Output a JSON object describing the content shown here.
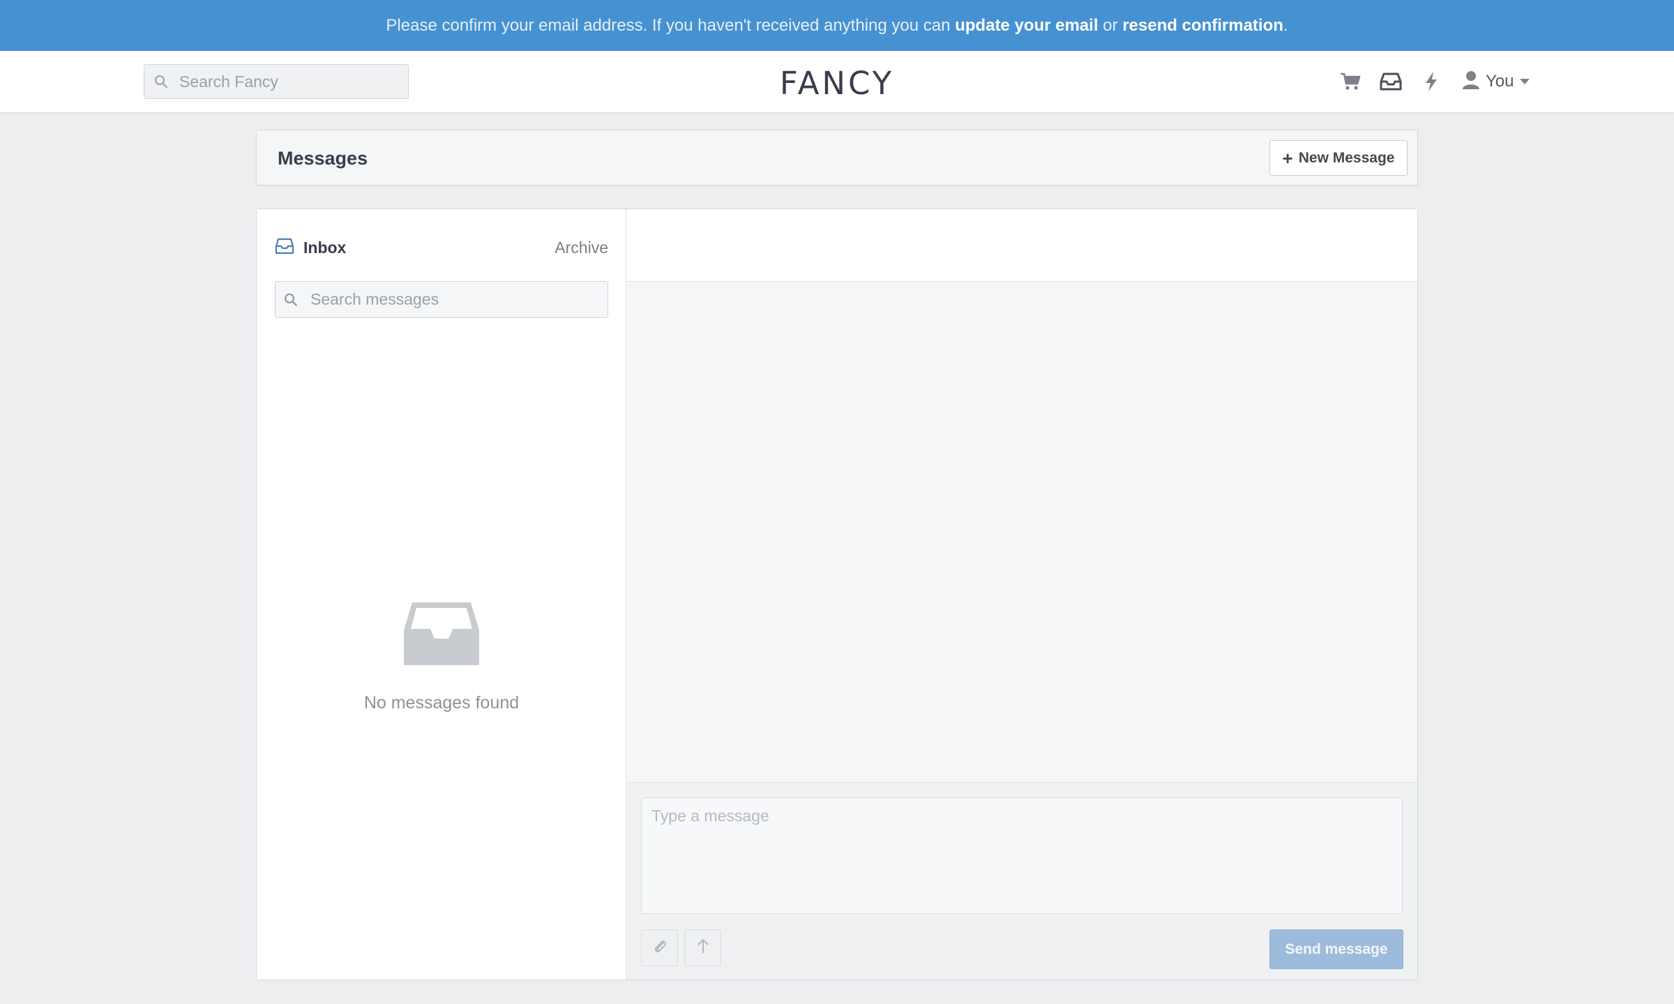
{
  "banner": {
    "prefix": "Please confirm your email address. If you haven't received anything you can ",
    "update_link": "update your email",
    "middle": " or ",
    "resend_link": "resend confirmation",
    "suffix": "."
  },
  "header": {
    "search_placeholder": "Search Fancy",
    "logo": "FANCY",
    "user_label": "You",
    "icons": [
      "cart-icon",
      "inbox-icon",
      "lightning-icon",
      "user-icon"
    ]
  },
  "messages": {
    "title": "Messages",
    "new_message_label": "New Message",
    "new_message_plus": "+",
    "tabs": {
      "inbox": "Inbox",
      "archive": "Archive"
    },
    "search_placeholder": "Search messages",
    "empty_text": "No messages found"
  },
  "composer": {
    "placeholder": "Type a message",
    "send_label": "Send message",
    "tools": [
      "paperclip-icon",
      "upload-arrow-icon"
    ]
  },
  "colors": {
    "banner": "#4691d1",
    "send_button": "#9dbcdc",
    "background": "#eceef0"
  }
}
